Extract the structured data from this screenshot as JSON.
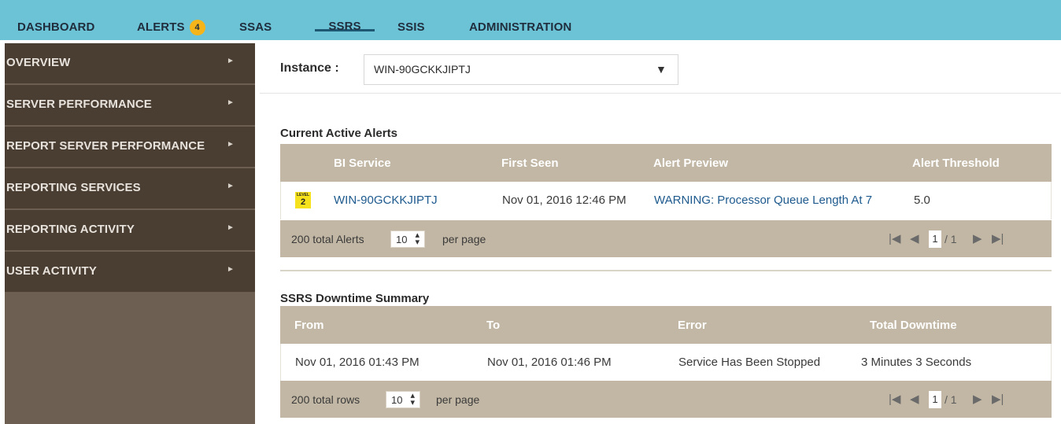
{
  "topnav": {
    "items": [
      {
        "label": "DASHBOARD"
      },
      {
        "label": "ALERTS",
        "badge": "4"
      },
      {
        "label": "SSAS"
      },
      {
        "label": "SSRS",
        "active": true
      },
      {
        "label": "SSIS"
      },
      {
        "label": "ADMINISTRATION"
      }
    ]
  },
  "sidebar": {
    "items": [
      {
        "label": "OVERVIEW"
      },
      {
        "label": "SERVER PERFORMANCE"
      },
      {
        "label": "REPORT SERVER PERFORMANCE"
      },
      {
        "label": "REPORTING SERVICES"
      },
      {
        "label": "REPORTING ACTIVITY"
      },
      {
        "label": "USER ACTIVITY"
      }
    ],
    "arrow": "►"
  },
  "instance": {
    "label": "Instance :",
    "value": "WIN-90GCKKJIPTJ",
    "caret": "▼"
  },
  "alerts": {
    "title": "Current Active Alerts",
    "columns": [
      "BI Service",
      "First Seen",
      "Alert Preview",
      "Alert Threshold"
    ],
    "rows": [
      {
        "level_label": "LEVEL",
        "level": "2",
        "level_color": "#f5e11c",
        "service": "WIN-90GCKKJIPTJ",
        "first_seen": "Nov 01, 2016 12:46 PM",
        "preview": "WARNING: Processor Queue Length At 7",
        "threshold": "5.0"
      }
    ],
    "pager": {
      "total": "200 total Alerts",
      "page_size": "10",
      "per_page": "per page",
      "page": "1",
      "of": "/ 1"
    }
  },
  "downtime": {
    "title": "SSRS Downtime Summary",
    "columns": [
      "From",
      "To",
      "Error",
      "Total Downtime"
    ],
    "rows": [
      {
        "from": "Nov 01, 2016 01:43 PM",
        "to": "Nov 01, 2016 01:46 PM",
        "error": "Service Has Been Stopped",
        "total": "3 Minutes 3 Seconds"
      }
    ],
    "pager": {
      "total": "200 total rows",
      "page_size": "10",
      "per_page": "per page",
      "page": "1",
      "of": "/ 1"
    }
  },
  "colors": {
    "nav_bg": "#6cc3d6",
    "sidebar_item_bg": "#4a3e33",
    "sidebar_bg": "#6d5f52",
    "table_header_bg": "#c2b7a4",
    "link": "#1e5a8e",
    "badge": "#f4b41a"
  }
}
